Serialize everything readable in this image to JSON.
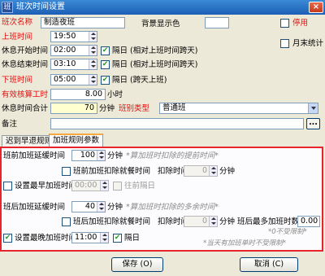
{
  "window": {
    "title": "班次时间设置",
    "app_icon": "app-icon",
    "close_label": "×"
  },
  "form": {
    "shift_name_label": "班次名称",
    "shift_name_value": "制造夜班",
    "bg_color_label": "背景显示色",
    "disabled_label": "停用",
    "month_end_label": "月末统计",
    "on_duty_label": "上班时间",
    "on_duty_value": "19:50",
    "rest_start_label": "休息开始时间",
    "rest_start_value": "02:00",
    "rest_start_nextday": "隔日 (相对上班时间跨天)",
    "rest_end_label": "休息结束时间",
    "rest_end_value": "03:10",
    "rest_end_nextday": "隔日 (相对上班时间跨天)",
    "off_duty_label": "下班时间",
    "off_duty_value": "05:00",
    "off_duty_nextday": "隔日 (跨天上班)",
    "valid_hours_label": "有效核算工时",
    "valid_hours_value": "8.00",
    "valid_hours_unit": "小时",
    "rest_total_label": "休息时间合计",
    "rest_total_value": "70",
    "rest_total_unit": "分钟",
    "shift_type_label": "班别类型",
    "shift_type_value": "普通班",
    "remark_label": "备注",
    "remark_value": "",
    "ellipsis_label": "..."
  },
  "tabs": [
    {
      "label": "迟到早退规则",
      "active": false
    },
    {
      "label": "加班规则参数",
      "active": true
    }
  ],
  "overtime": {
    "pre_delay_label": "班前加班延缓时间",
    "pre_delay_value": "100",
    "pre_delay_unit": "分钟",
    "pre_delay_hint": "*算加班时扣除的提前时间*",
    "pre_deduct_meal_label": "班前加班扣除就餐时间",
    "pre_deduct_time_label": "扣除时间",
    "pre_deduct_time_value": "0",
    "pre_deduct_time_unit": "分钟",
    "earliest_label": "设置最早加班时间",
    "earliest_value": "00:00",
    "earliest_prev_day": "往前隔日",
    "post_delay_label": "班后加班延缓时间",
    "post_delay_value": "40",
    "post_delay_unit": "分钟",
    "post_delay_hint": "*算加班时扣除的多余时间*",
    "post_deduct_meal_label": "班后加班扣除就餐时间",
    "post_deduct_time_label": "扣除时间",
    "post_deduct_time_value": "0",
    "post_deduct_time_unit": "分钟",
    "post_max_label": "班后最多加班时数",
    "post_max_value": "0.00",
    "latest_label": "设置最晚加班时间",
    "latest_value": "11:00",
    "latest_next_day": "隔日",
    "note1": "*0不受限制*",
    "note2": "*当天有加班单时不受限制*"
  },
  "buttons": {
    "save": "保存 (O)",
    "cancel": "取消 (C)"
  },
  "colors": {
    "accent_red": "#e8242c",
    "title_blue": "#1c5fb5"
  }
}
